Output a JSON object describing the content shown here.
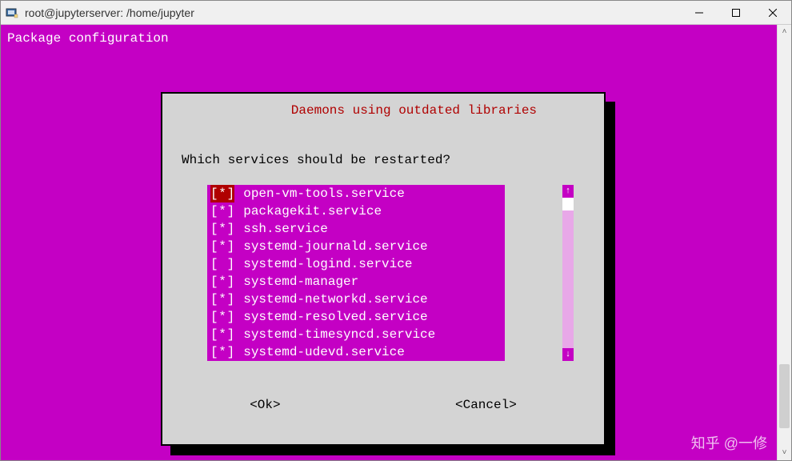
{
  "window": {
    "title": "root@jupyterserver: /home/jupyter"
  },
  "terminal": {
    "header": "Package configuration"
  },
  "dialog": {
    "title": "Daemons using outdated libraries",
    "prompt": "Which services should be restarted?",
    "items": [
      {
        "checked": true,
        "highlight": true,
        "label": "open-vm-tools.service"
      },
      {
        "checked": true,
        "highlight": false,
        "label": "packagekit.service"
      },
      {
        "checked": true,
        "highlight": false,
        "label": "ssh.service"
      },
      {
        "checked": true,
        "highlight": false,
        "label": "systemd-journald.service"
      },
      {
        "checked": false,
        "highlight": false,
        "label": "systemd-logind.service"
      },
      {
        "checked": true,
        "highlight": false,
        "label": "systemd-manager"
      },
      {
        "checked": true,
        "highlight": false,
        "label": "systemd-networkd.service"
      },
      {
        "checked": true,
        "highlight": false,
        "label": "systemd-resolved.service"
      },
      {
        "checked": true,
        "highlight": false,
        "label": "systemd-timesyncd.service"
      },
      {
        "checked": true,
        "highlight": false,
        "label": "systemd-udevd.service"
      }
    ],
    "ok": "<Ok>",
    "cancel": "<Cancel>"
  },
  "watermark": "知乎 @一修"
}
